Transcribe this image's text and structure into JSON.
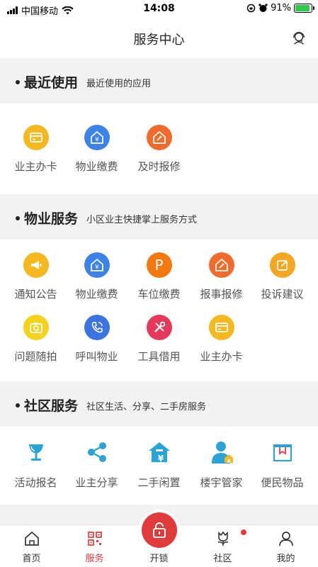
{
  "status_bar": {
    "carrier": "中国移动",
    "time": "14:08",
    "battery": "91%",
    "battery_level": 0.91
  },
  "header": {
    "title": "服务中心",
    "service_icon": "customer-service-icon"
  },
  "sections": {
    "recent": {
      "title": "最近使用",
      "subtitle": "最近使用的应用",
      "items": [
        {
          "label": "业主办卡",
          "icon": "card-icon",
          "color": "#f5b81e"
        },
        {
          "label": "物业缴费",
          "icon": "property-fee-icon",
          "color": "#3d82e8"
        },
        {
          "label": "及时报修",
          "icon": "repair-icon",
          "color": "#f26b2a"
        }
      ]
    },
    "property": {
      "title": "物业服务",
      "subtitle": "小区业主快捷掌上服务方式",
      "items": [
        {
          "label": "通知公告",
          "icon": "megaphone-icon",
          "color": "#f5b81e"
        },
        {
          "label": "物业缴费",
          "icon": "property-fee-icon",
          "color": "#3d82e8"
        },
        {
          "label": "车位缴费",
          "icon": "parking-icon",
          "color": "#f5780f",
          "glyph": "P"
        },
        {
          "label": "报事报修",
          "icon": "repair-icon",
          "color": "#f26b2a"
        },
        {
          "label": "投诉建议",
          "icon": "edit-icon",
          "color": "#f5a623"
        },
        {
          "label": "问题随拍",
          "icon": "camera-icon",
          "color": "#f7d21c"
        },
        {
          "label": "呼叫物业",
          "icon": "phone-icon",
          "color": "#3b74e0"
        },
        {
          "label": "工具借用",
          "icon": "tools-icon",
          "color": "#e8385a"
        },
        {
          "label": "业主办卡",
          "icon": "card-icon",
          "color": "#f5b81e"
        }
      ]
    },
    "community": {
      "title": "社区服务",
      "subtitle": "社区生活、分享、二手房服务",
      "items": [
        {
          "label": "活动报名",
          "icon": "trophy-icon",
          "color": "#2aa3d8"
        },
        {
          "label": "业主分享",
          "icon": "share-icon",
          "color": "#2aa3d8"
        },
        {
          "label": "二手闲置",
          "icon": "house-sale-icon",
          "color": "#2aa3d8"
        },
        {
          "label": "楼宇管家",
          "icon": "butler-icon",
          "color": "#2aa3d8"
        },
        {
          "label": "便民物品",
          "icon": "box-icon",
          "color": "#2aa3d8"
        }
      ]
    }
  },
  "tab_bar": {
    "items": [
      {
        "label": "首页",
        "icon": "home-icon"
      },
      {
        "label": "服务",
        "icon": "grid-icon",
        "active": true
      },
      {
        "label": "开锁",
        "icon": "unlock-icon"
      },
      {
        "label": "社区",
        "icon": "tulip-icon",
        "has_badge": true
      },
      {
        "label": "我的",
        "icon": "person-icon"
      }
    ],
    "accent_color": "#e03a3a"
  }
}
